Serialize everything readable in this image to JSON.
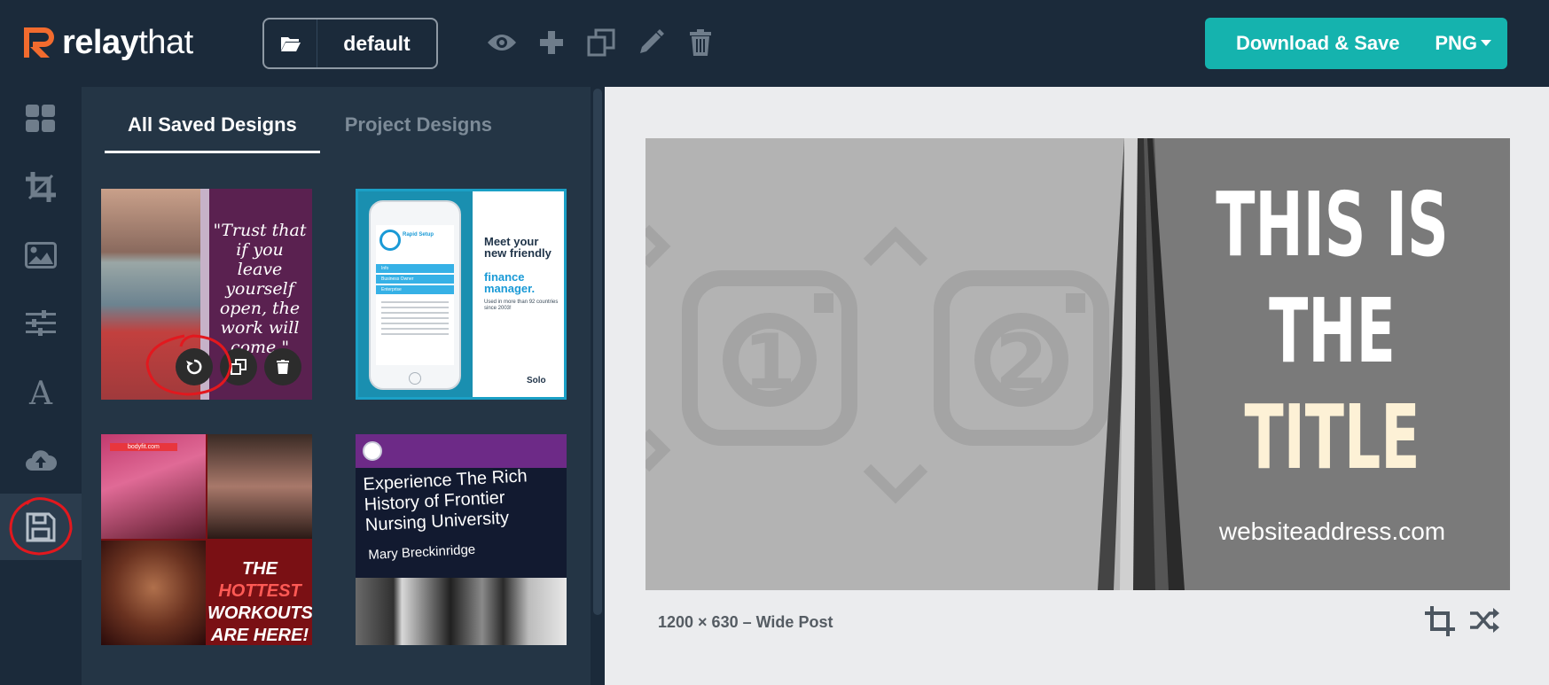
{
  "app": {
    "logo_text_bold": "relay",
    "logo_text_thin": "that",
    "brand_color": "#f26b2e"
  },
  "toolbar": {
    "project_name": "default",
    "download_label": "Download & Save",
    "format": "PNG",
    "icons": [
      "folder-icon",
      "eye-icon",
      "plus-icon",
      "duplicate-icon",
      "pencil-icon",
      "trash-icon"
    ],
    "accent_color": "#15b3ae"
  },
  "sidebar": {
    "items": [
      "grid-icon",
      "crop-icon",
      "image-icon",
      "sliders-icon",
      "text-icon",
      "cloud-upload-icon",
      "save-icon"
    ],
    "active": "save-icon"
  },
  "panel": {
    "tabs": [
      {
        "label": "All Saved Designs",
        "active": true
      },
      {
        "label": "Project Designs",
        "active": false
      }
    ],
    "designs": [
      {
        "quote": "\"Trust that if you leave yourself open, the work will come.\"",
        "actions": [
          "restore-icon",
          "duplicate-icon",
          "trash-icon"
        ]
      },
      {
        "phone_title": "Rapid Setup",
        "menu": [
          "Info",
          "Business Owner",
          "Enterprise"
        ],
        "heading_1": "Meet your new friendly",
        "heading_2": "finance manager.",
        "subtext": "Used in more than 92 countries since 2003!",
        "brand": "Solo"
      },
      {
        "tag": "bodyfit.com",
        "line_1a": "THE ",
        "line_1b": "HOTTEST",
        "line_2": "WORKOUTS",
        "line_3": "ARE HERE!"
      },
      {
        "title": "Experience The Rich History of Frontier Nursing University",
        "subtitle": "Mary Breckinridge"
      }
    ]
  },
  "preview": {
    "title_line_1": "THIS IS",
    "title_line_2": "THE",
    "title_line_3": "TITLE",
    "website": "websiteaddress.com",
    "placeholder_1": "1",
    "placeholder_2": "2",
    "highlight_color": "#fdf1d6",
    "size_label": "1200 × 630 – Wide Post"
  }
}
